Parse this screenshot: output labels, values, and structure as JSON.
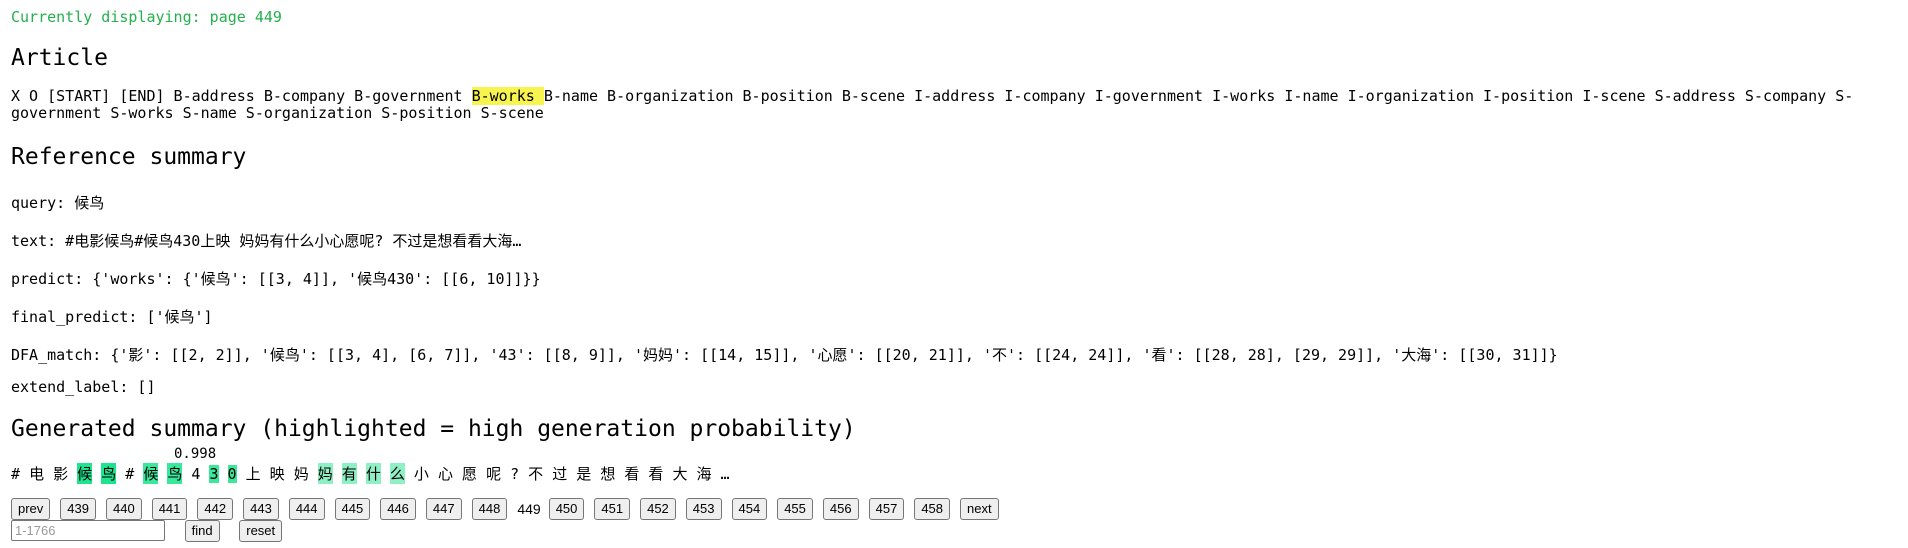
{
  "status": "Currently displaying: page 449",
  "article": {
    "heading": "Article",
    "tags_before": "X O [START] [END] B-address B-company B-government ",
    "tag_highlighted": "B-works ",
    "tags_after": "B-name B-organization B-position B-scene I-address I-company I-government I-works I-name I-organization I-position I-scene S-address S-company S-government S-works S-name S-organization S-position S-scene"
  },
  "reference": {
    "heading": "Reference summary",
    "query": "query: 候鸟",
    "text": "text: #电影候鸟#候鸟430上映 妈妈有什么小心愿呢? 不过是想看看大海…",
    "predict": "predict: {'works': {'候鸟': [[3, 4]], '候鸟430': [[6, 10]]}}",
    "final_predict": "final_predict: ['候鸟']",
    "dfa_match": "DFA_match: {'影': [[2, 2]], '候鸟': [[3, 4], [6, 7]], '43': [[8, 9]], '妈妈': [[14, 15]], '心愿': [[20, 21]], '不': [[24, 24]], '看': [[28, 28], [29, 29]], '大海': [[30, 31]]}",
    "extend_label": "extend_label: []"
  },
  "generated": {
    "heading": "Generated summary (highlighted = high generation probability)",
    "probability_label": "0.998",
    "tokens": [
      {
        "t": "#",
        "h": ""
      },
      {
        "t": "电",
        "h": ""
      },
      {
        "t": "影",
        "h": ""
      },
      {
        "t": "候",
        "h": "h1"
      },
      {
        "t": "鸟",
        "h": "h1"
      },
      {
        "t": "#",
        "h": ""
      },
      {
        "t": "候",
        "h": "h2"
      },
      {
        "t": "鸟",
        "h": "h2"
      },
      {
        "t": "4",
        "h": ""
      },
      {
        "t": "3",
        "h": "h2"
      },
      {
        "t": "0",
        "h": "h2"
      },
      {
        "t": "上",
        "h": ""
      },
      {
        "t": "映",
        "h": ""
      },
      {
        "t": "妈",
        "h": ""
      },
      {
        "t": "妈",
        "h": "h3"
      },
      {
        "t": "有",
        "h": "h3"
      },
      {
        "t": "什",
        "h": "h3"
      },
      {
        "t": "么",
        "h": "h3"
      },
      {
        "t": "小",
        "h": ""
      },
      {
        "t": "心",
        "h": ""
      },
      {
        "t": "愿",
        "h": ""
      },
      {
        "t": "呢",
        "h": ""
      },
      {
        "t": "?",
        "h": ""
      },
      {
        "t": "不",
        "h": ""
      },
      {
        "t": "过",
        "h": ""
      },
      {
        "t": "是",
        "h": ""
      },
      {
        "t": "想",
        "h": ""
      },
      {
        "t": "看",
        "h": ""
      },
      {
        "t": "看",
        "h": ""
      },
      {
        "t": "大",
        "h": ""
      },
      {
        "t": "海",
        "h": ""
      },
      {
        "t": "…",
        "h": ""
      }
    ]
  },
  "pager": {
    "prev": "prev",
    "pages_before": [
      "439",
      "440",
      "441",
      "442",
      "443",
      "444",
      "445",
      "446",
      "447",
      "448"
    ],
    "current": "449",
    "pages_after": [
      "450",
      "451",
      "452",
      "453",
      "454",
      "455",
      "456",
      "457",
      "458"
    ],
    "next": "next"
  },
  "find": {
    "placeholder": "1-1766",
    "value": "",
    "find_label": "find",
    "reset_label": "reset"
  },
  "colors": {
    "status_green": "#22b14c",
    "highlight_yellow": "#f7f34f",
    "highlight_green_strong": "#1fe38f",
    "highlight_green_light": "#8ef0c4"
  }
}
